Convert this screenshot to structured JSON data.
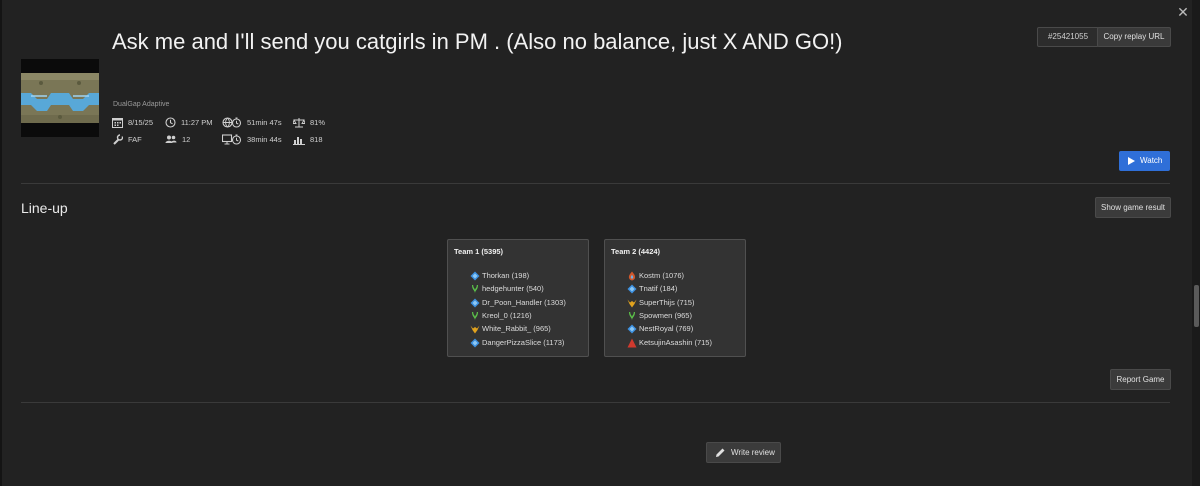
{
  "game": {
    "title": "Ask me and I'll send you catgirls in PM . (Also no balance, just X AND GO!)",
    "replay_id": "#25421055",
    "copy_replay_url_label": "Copy replay URL",
    "map_name": "DualGap Adaptive",
    "date": "8/15/25",
    "time": "11:27 PM",
    "game_duration": "51min 47s",
    "quality": "81%",
    "featured_mod": "FAF",
    "player_count": "12",
    "replay_duration": "38min 44s",
    "avg_rating": "818",
    "watch_label": "Watch"
  },
  "lineup": {
    "title": "Line-up",
    "show_result_label": "Show game result",
    "report_label": "Report Game",
    "teams": [
      {
        "title": "Team 1 (5395)",
        "players": [
          {
            "name": "Thorkan",
            "rating": "(198)",
            "faction": "aeon"
          },
          {
            "name": "hedgehunter",
            "rating": "(540)",
            "faction": "seraphim"
          },
          {
            "name": "Dr_Poon_Handler",
            "rating": "(1303)",
            "faction": "aeon"
          },
          {
            "name": "Kreol_0",
            "rating": "(1216)",
            "faction": "seraphim"
          },
          {
            "name": "White_Rabbit_",
            "rating": "(965)",
            "faction": "cybran"
          },
          {
            "name": "DangerPizzaSlice",
            "rating": "(1173)",
            "faction": "aeon"
          }
        ]
      },
      {
        "title": "Team 2 (4424)",
        "players": [
          {
            "name": "Kostm",
            "rating": "(1076)",
            "faction": "random"
          },
          {
            "name": "Tnatif",
            "rating": "(184)",
            "faction": "aeon"
          },
          {
            "name": "SuperThijs",
            "rating": "(715)",
            "faction": "cybran"
          },
          {
            "name": "Spowmen",
            "rating": "(965)",
            "faction": "seraphim"
          },
          {
            "name": "NestRoyal",
            "rating": "(769)",
            "faction": "aeon"
          },
          {
            "name": "KetsujinAsashin",
            "rating": "(715)",
            "faction": "uef"
          }
        ]
      }
    ]
  },
  "review": {
    "write_review_label": "Write review"
  },
  "colors": {
    "accent": "#2f6fd8",
    "aeon": "#3b8fe0",
    "seraphim": "#5cc24a",
    "cybran": "#e0a21e",
    "uef": "#d03a2e"
  }
}
